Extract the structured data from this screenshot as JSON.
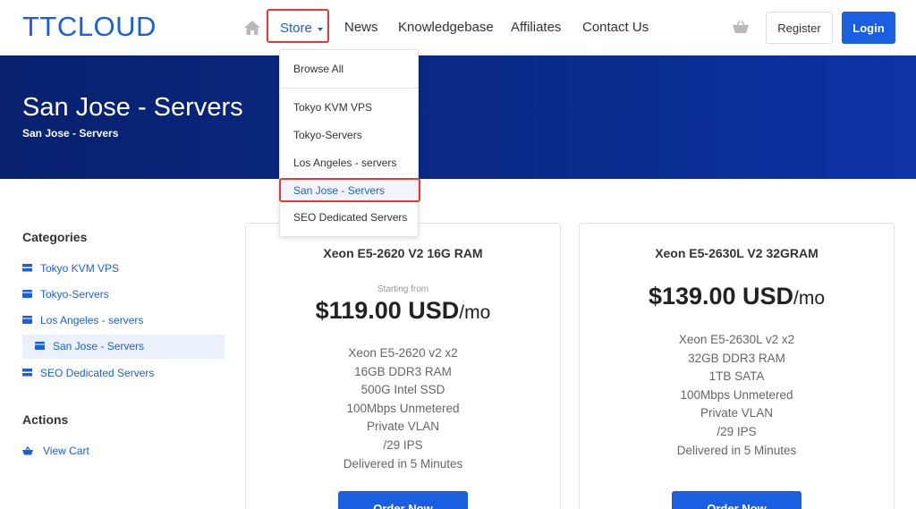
{
  "header": {
    "logo": "TTCLOUD",
    "nav": {
      "store": "Store",
      "news": "News",
      "knowledgebase": "Knowledgebase",
      "affiliates": "Affiliates",
      "contact": "Contact Us"
    },
    "register_label": "Register",
    "login_label": "Login",
    "icons": {
      "home": "home-icon",
      "cart": "cart-icon"
    }
  },
  "store_menu": {
    "browse_all": "Browse All",
    "items": [
      "Tokyo KVM VPS",
      "Tokyo-Servers",
      "Los Angeles - servers",
      "San Jose - Servers",
      "SEO Dedicated Servers"
    ],
    "active": "San Jose - Servers"
  },
  "banner": {
    "title": "San Jose - Servers",
    "breadcrumb": "San Jose - Servers"
  },
  "sidebar": {
    "categories_heading": "Categories",
    "categories": [
      {
        "label": "Tokyo KVM VPS",
        "icon": "server-icon"
      },
      {
        "label": "Tokyo-Servers",
        "icon": "box-icon"
      },
      {
        "label": "Los Angeles - servers",
        "icon": "box-icon"
      },
      {
        "label": "San Jose - Servers",
        "icon": "box-icon",
        "active": true
      },
      {
        "label": "SEO Dedicated Servers",
        "icon": "server-icon"
      }
    ],
    "actions_heading": "Actions",
    "actions": [
      {
        "label": "View Cart",
        "icon": "cart-icon"
      }
    ]
  },
  "products": [
    {
      "name": "Xeon E5-2620 V2 16G RAM",
      "starting_from": "Starting from",
      "price": "$119.00 USD",
      "period": "/mo",
      "features": [
        "Xeon E5-2620 v2 x2",
        "16GB DDR3 RAM",
        "500G Intel SSD",
        "100Mbps Unmetered",
        "Private VLAN",
        "/29 IPS",
        "Delivered in 5 Minutes"
      ],
      "order_label": "Order Now"
    },
    {
      "name": "Xeon E5-2630L V2 32GRAM",
      "price": "$139.00 USD",
      "period": "/mo",
      "features": [
        "Xeon E5-2630L v2 x2",
        "32GB DDR3 RAM",
        "1TB SATA",
        "100Mbps Unmetered",
        "Private VLAN",
        "/29 IPS",
        "Delivered in 5 Minutes"
      ],
      "order_label": "Order Now"
    }
  ],
  "colors": {
    "accent": "#1a5fe0",
    "banner": "#0a2a87",
    "highlight": "#e53935"
  }
}
